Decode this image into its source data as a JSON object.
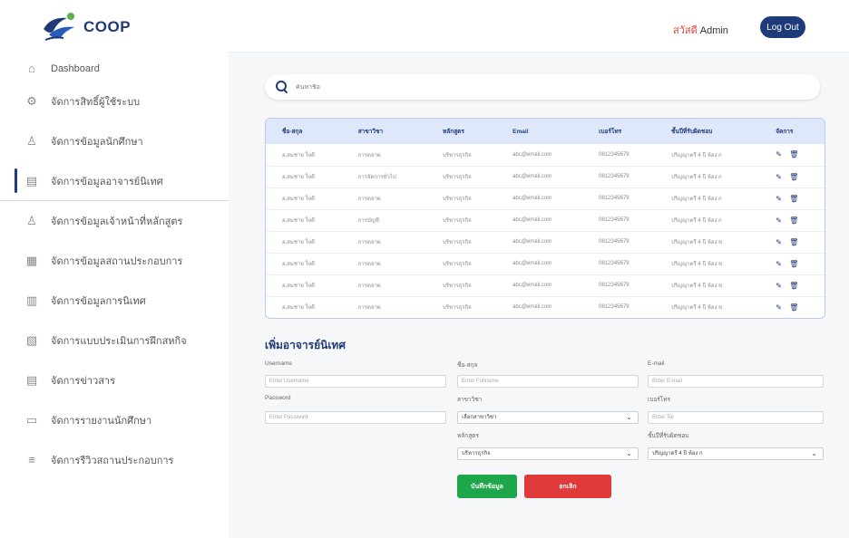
{
  "app": {
    "logo_text": "COOP"
  },
  "header": {
    "role": "สวัสดี",
    "user": "Admin",
    "logout_label": "Log Out"
  },
  "sidebar": {
    "items": [
      {
        "label": "Dashboard",
        "icon": "home-icon"
      },
      {
        "label": "จัดการสิทธิ์ผู้ใช้ระบบ",
        "icon": "user-settings-icon"
      },
      {
        "label": "จัดการข้อมูลนักศึกษา",
        "icon": "student-icon"
      },
      {
        "label": "จัดการข้อมูลอาจารย์นิเทศ",
        "icon": "teacher-icon"
      },
      {
        "label": "จัดการข้อมูลเจ้าหน้าที่หลักสูตร",
        "icon": "staff-icon"
      },
      {
        "label": "จัดการข้อมูลสถานประกอบการ",
        "icon": "building-icon"
      },
      {
        "label": "จัดการข้อมูลการนิเทศ",
        "icon": "document-icon"
      },
      {
        "label": "จัดการแบบประเมินการฝึกสหกิจ",
        "icon": "clipboard-icon"
      },
      {
        "label": "จัดการข่าวสาร",
        "icon": "news-icon"
      },
      {
        "label": "จัดการรายงานนักศึกษา",
        "icon": "report-icon"
      },
      {
        "label": "จัดการรีวิวสถานประกอบการ",
        "icon": "list-icon"
      }
    ],
    "active_index": 3
  },
  "search": {
    "placeholder": "ค้นหาชื่อ"
  },
  "table": {
    "headers": [
      "ชื่อ-สกุล",
      "สาขาวิชา",
      "หลักสูตร",
      "Email",
      "เบอร์โทร",
      "ชั้นปีที่รับผิดชอบ",
      "จัดการ"
    ],
    "rows": [
      [
        "อ.สมชาย ใจดี",
        "การตลาด",
        "บริหารธุรกิจ",
        "abc@email.com",
        "0812345678",
        "ปริญญาตรี 4 ปี ห้อง ก",
        "✎ 🗑"
      ],
      [
        "อ.สมชาย ใจดี",
        "การจัดการทั่วไป",
        "บริหารธุรกิจ",
        "abc@email.com",
        "0812345678",
        "ปริญญาตรี 4 ปี ห้อง ก",
        "✎ 🗑"
      ],
      [
        "อ.สมชาย ใจดี",
        "การตลาด",
        "บริหารธุรกิจ",
        "abc@email.com",
        "0812345678",
        "ปริญญาตรี 4 ปี ห้อง ก",
        "✎ 🗑"
      ],
      [
        "อ.สมชาย ใจดี",
        "การบัญชี",
        "บริหารธุรกิจ",
        "abc@email.com",
        "0812345678",
        "ปริญญาตรี 4 ปี ห้อง ก",
        "✎ 🗑"
      ],
      [
        "อ.สมชาย ใจดี",
        "การตลาด",
        "บริหารธุรกิจ",
        "abc@email.com",
        "0812345678",
        "ปริญญาตรี 4 ปี ห้อง ข",
        "✎ 🗑"
      ],
      [
        "อ.สมชาย ใจดี",
        "การตลาด",
        "บริหารธุรกิจ",
        "abc@email.com",
        "0812345678",
        "ปริญญาตรี 4 ปี ห้อง ข",
        "✎ 🗑"
      ],
      [
        "อ.สมชาย ใจดี",
        "การตลาด",
        "บริหารธุรกิจ",
        "abc@email.com",
        "0812345678",
        "ปริญญาตรี 4 ปี ห้อง ข",
        "✎ 🗑"
      ],
      [
        "อ.สมชาย ใจดี",
        "การตลาด",
        "บริหารธุรกิจ",
        "abc@email.com",
        "0812345678",
        "ปริญญาตรี 4 ปี ห้อง ข",
        "✎ 🗑"
      ]
    ]
  },
  "form": {
    "title": "เพิ่มอาจารย์นิเทศ",
    "username": {
      "label": "Username",
      "placeholder": "Enter Username"
    },
    "password": {
      "label": "Password",
      "placeholder": "Enter Password"
    },
    "fullname": {
      "label": "ชื่อ-สกุล",
      "placeholder": "Enter Fullname"
    },
    "major": {
      "label": "สาขาวิชา",
      "value": "เลือกสาขาวิชา"
    },
    "curriculum": {
      "label": "หลักสูตร",
      "value": "บริหารธุรกิจ"
    },
    "email": {
      "label": "E-mail",
      "placeholder": "Enter E-mail"
    },
    "phone": {
      "label": "เบอร์โทร",
      "placeholder": "Enter Tel"
    },
    "year": {
      "label": "ชั้นปีที่รับผิดชอบ",
      "value": "ปริญญาตรี 4 ปี ห้อง ก"
    },
    "save_label": "บันทึกข้อมูล",
    "cancel_label": "ยกเลิก"
  }
}
